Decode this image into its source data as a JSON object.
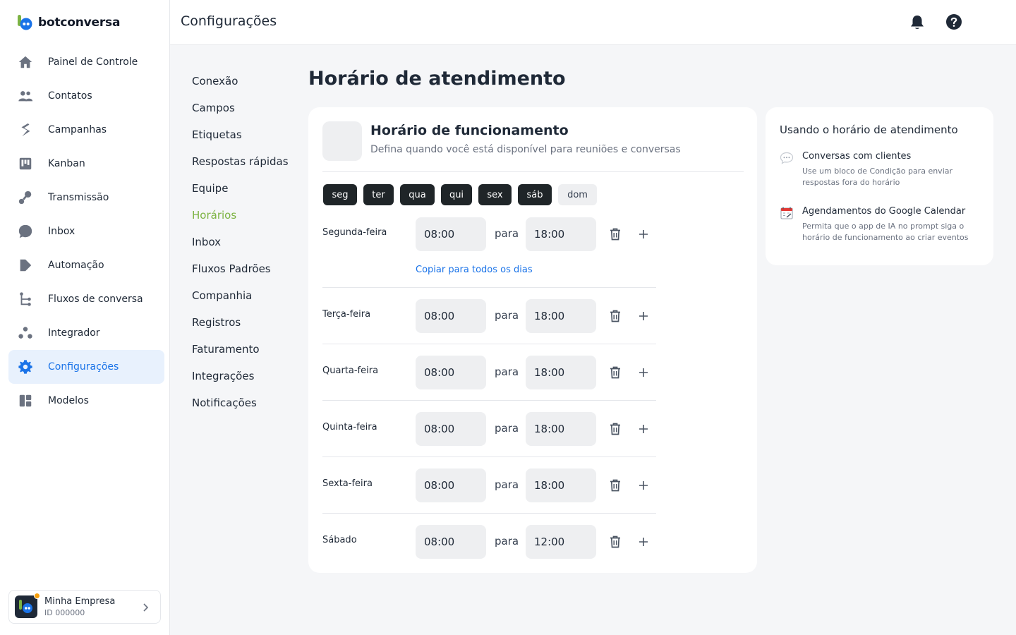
{
  "app": {
    "brand": "botconversa"
  },
  "sidebar": {
    "items": [
      {
        "label": "Painel de Controle",
        "icon": "home-icon"
      },
      {
        "label": "Contatos",
        "icon": "users-icon"
      },
      {
        "label": "Campanhas",
        "icon": "campaign-icon"
      },
      {
        "label": "Kanban",
        "icon": "kanban-icon"
      },
      {
        "label": "Transmissão",
        "icon": "broadcast-icon"
      },
      {
        "label": "Inbox",
        "icon": "chat-bubble-icon"
      },
      {
        "label": "Automação",
        "icon": "automation-icon"
      },
      {
        "label": "Fluxos de conversa",
        "icon": "flow-icon"
      },
      {
        "label": "Integrador",
        "icon": "integrator-icon"
      },
      {
        "label": "Configurações",
        "icon": "gear-icon",
        "active": true
      },
      {
        "label": "Modelos",
        "icon": "templates-icon"
      }
    ]
  },
  "company": {
    "name": "Minha Empresa",
    "id": "ID 000000"
  },
  "header": {
    "title": "Configurações"
  },
  "settings_menu": {
    "items": [
      "Conexão",
      "Campos",
      "Etiquetas",
      "Respostas rápidas",
      "Equipe",
      "Horários",
      "Inbox",
      "Fluxos Padrões",
      "Companhia",
      "Registros",
      "Faturamento",
      "Integrações",
      "Notificações"
    ],
    "active": "Horários"
  },
  "page": {
    "title": "Horário de atendimento"
  },
  "schedule_card": {
    "title": "Horário de funcionamento",
    "subtitle": "Defina quando você está disponível para reuniões e conversas",
    "day_chips": [
      {
        "label": "seg",
        "on": true
      },
      {
        "label": "ter",
        "on": true
      },
      {
        "label": "qua",
        "on": true
      },
      {
        "label": "qui",
        "on": true
      },
      {
        "label": "sex",
        "on": true
      },
      {
        "label": "sáb",
        "on": true
      },
      {
        "label": "dom",
        "on": false
      }
    ],
    "separator": "para",
    "copy_all_label": "Copiar para todos os dias",
    "days": [
      {
        "name": "Segunda-feira",
        "from": "08:00",
        "to": "18:00"
      },
      {
        "name": "Terça-feira",
        "from": "08:00",
        "to": "18:00"
      },
      {
        "name": "Quarta-feira",
        "from": "08:00",
        "to": "18:00"
      },
      {
        "name": "Quinta-feira",
        "from": "08:00",
        "to": "18:00"
      },
      {
        "name": "Sexta-feira",
        "from": "08:00",
        "to": "18:00"
      },
      {
        "name": "Sábado",
        "from": "08:00",
        "to": "12:00"
      }
    ]
  },
  "info_card": {
    "title": "Usando o horário de atendimento",
    "items": [
      {
        "name": "Conversas com clientes",
        "desc": "Use um bloco de Condição para enviar respostas fora do horário",
        "icon": "speech-bubble-icon"
      },
      {
        "name": "Agendamentos do Google Calendar",
        "desc": "Permita que o app de IA no prompt siga o horário de funcionamento ao criar eventos",
        "icon": "calendar-icon"
      }
    ]
  },
  "colors": {
    "accent": "#1a73e8",
    "active_menu": "#7cb342",
    "chip_on": "#1f2528",
    "brand_green": "#7cb342"
  }
}
